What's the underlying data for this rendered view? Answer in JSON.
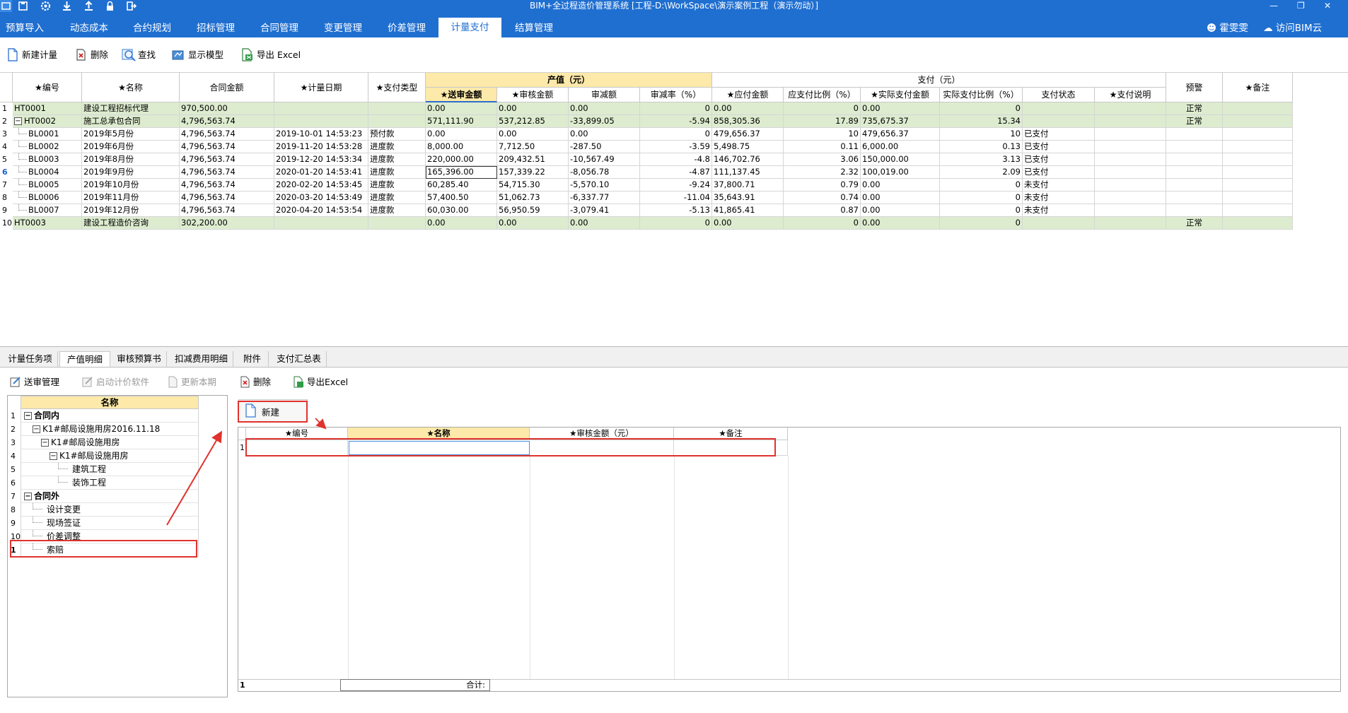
{
  "window": {
    "title": "BIM+全过程造价管理系统 [工程-D:\\WorkSpace\\演示案例工程（演示勿动）]",
    "quick_icons": [
      "app-logo-icon",
      "save-icon",
      "settings-icon",
      "download-icon",
      "upload-icon",
      "lock-icon",
      "exit-icon"
    ],
    "user": "霍雯雯",
    "cloud": "访问BIM云"
  },
  "menu": {
    "tabs": [
      {
        "label": "预算导入"
      },
      {
        "label": "动态成本"
      },
      {
        "label": "合约规划"
      },
      {
        "label": "招标管理"
      },
      {
        "label": "合同管理"
      },
      {
        "label": "变更管理"
      },
      {
        "label": "价差管理"
      },
      {
        "label": "计量支付"
      },
      {
        "label": "结算管理"
      }
    ],
    "active": "计量支付"
  },
  "toolbar": {
    "new": "新建计量",
    "delete": "删除",
    "find": "查找",
    "model": "显示模型",
    "export": "导出 Excel"
  },
  "grid": {
    "group_output": "产值（元）",
    "group_pay": "支付（元）",
    "headers": {
      "code": "★编号",
      "name": "★名称",
      "contract_amount": "合同金额",
      "date": "★计量日期",
      "pay_type": "★支付类型",
      "submitted": "★送审金额",
      "audited": "★审核金额",
      "reduction": "审减额",
      "reduction_rate": "审减率（%）",
      "payable": "★应付金额",
      "payable_ratio": "应支付比例（%）",
      "actual": "★实际支付金额",
      "actual_ratio": "实际支付比例（%）",
      "status": "支付状态",
      "note_pay": "★支付说明",
      "warning": "预警",
      "remark": "★备注"
    },
    "rows": [
      {
        "n": "1",
        "code": "HT0001",
        "name": "建设工程招标代理",
        "contract": "970,500.00",
        "date": "",
        "type": "",
        "submitted": "0.00",
        "audited": "0.00",
        "reduction": "0.00",
        "rate": "0",
        "payable": "0.00",
        "pratio": "0",
        "actual": "0.00",
        "aratio": "0",
        "status": "",
        "warn": "正常"
      },
      {
        "n": "2",
        "code": "HT0002",
        "name": "施工总承包合同",
        "contract": "4,796,563.74",
        "date": "",
        "type": "",
        "submitted": "571,111.90",
        "audited": "537,212.85",
        "reduction": "-33,899.05",
        "rate": "-5.94",
        "payable": "858,305.36",
        "pratio": "17.89",
        "actual": "735,675.37",
        "aratio": "15.34",
        "status": "",
        "warn": "正常"
      },
      {
        "n": "3",
        "code": "BL0001",
        "name": "2019年5月份",
        "contract": "4,796,563.74",
        "date": "2019-10-01 14:53:23",
        "type": "预付款",
        "submitted": "0.00",
        "audited": "0.00",
        "reduction": "0.00",
        "rate": "0",
        "payable": "479,656.37",
        "pratio": "10",
        "actual": "479,656.37",
        "aratio": "10",
        "status": "已支付",
        "warn": ""
      },
      {
        "n": "4",
        "code": "BL0002",
        "name": "2019年6月份",
        "contract": "4,796,563.74",
        "date": "2019-11-20 14:53:28",
        "type": "进度款",
        "submitted": "8,000.00",
        "audited": "7,712.50",
        "reduction": "-287.50",
        "rate": "-3.59",
        "payable": "5,498.75",
        "pratio": "0.11",
        "actual": "6,000.00",
        "aratio": "0.13",
        "status": "已支付",
        "warn": ""
      },
      {
        "n": "5",
        "code": "BL0003",
        "name": "2019年8月份",
        "contract": "4,796,563.74",
        "date": "2019-12-20 14:53:34",
        "type": "进度款",
        "submitted": "220,000.00",
        "audited": "209,432.51",
        "reduction": "-10,567.49",
        "rate": "-4.8",
        "payable": "146,702.76",
        "pratio": "3.06",
        "actual": "150,000.00",
        "aratio": "3.13",
        "status": "已支付",
        "warn": ""
      },
      {
        "n": "6",
        "code": "BL0004",
        "name": "2019年9月份",
        "contract": "4,796,563.74",
        "date": "2020-01-20 14:53:41",
        "type": "进度款",
        "submitted": "165,396.00",
        "audited": "157,339.22",
        "reduction": "-8,056.78",
        "rate": "-4.87",
        "payable": "111,137.45",
        "pratio": "2.32",
        "actual": "100,019.00",
        "aratio": "2.09",
        "status": "已支付",
        "warn": ""
      },
      {
        "n": "7",
        "code": "BL0005",
        "name": "2019年10月份",
        "contract": "4,796,563.74",
        "date": "2020-02-20 14:53:45",
        "type": "进度款",
        "submitted": "60,285.40",
        "audited": "54,715.30",
        "reduction": "-5,570.10",
        "rate": "-9.24",
        "payable": "37,800.71",
        "pratio": "0.79",
        "actual": "0.00",
        "aratio": "0",
        "status": "未支付",
        "warn": ""
      },
      {
        "n": "8",
        "code": "BL0006",
        "name": "2019年11月份",
        "contract": "4,796,563.74",
        "date": "2020-03-20 14:53:49",
        "type": "进度款",
        "submitted": "57,400.50",
        "audited": "51,062.73",
        "reduction": "-6,337.77",
        "rate": "-11.04",
        "payable": "35,643.91",
        "pratio": "0.74",
        "actual": "0.00",
        "aratio": "0",
        "status": "未支付",
        "warn": ""
      },
      {
        "n": "9",
        "code": "BL0007",
        "name": "2019年12月份",
        "contract": "4,796,563.74",
        "date": "2020-04-20 14:53:54",
        "type": "进度款",
        "submitted": "60,030.00",
        "audited": "56,950.59",
        "reduction": "-3,079.41",
        "rate": "-5.13",
        "payable": "41,865.41",
        "pratio": "0.87",
        "actual": "0.00",
        "aratio": "0",
        "status": "未支付",
        "warn": ""
      },
      {
        "n": "10",
        "code": "HT0003",
        "name": "建设工程造价咨询",
        "contract": "302,200.00",
        "date": "",
        "type": "",
        "submitted": "0.00",
        "audited": "0.00",
        "reduction": "0.00",
        "rate": "0",
        "payable": "0.00",
        "pratio": "0",
        "actual": "0.00",
        "aratio": "0",
        "status": "",
        "warn": "正常"
      }
    ]
  },
  "bottom_tabs": [
    "计量任务项",
    "产值明细",
    "审核预算书",
    "扣减费用明细",
    "附件",
    "支付汇总表"
  ],
  "bottom_active": "产值明细",
  "subtoolbar": {
    "review": "送审管理",
    "start_pricing": "启动计价软件",
    "update": "更新本期",
    "delete": "删除",
    "export": "导出Excel"
  },
  "tree": {
    "header": "名称",
    "rows": [
      {
        "n": "1",
        "label": "合同内",
        "level": 0,
        "expander": "−",
        "bold": true
      },
      {
        "n": "2",
        "label": "K1#邮局设施用房2016.11.18",
        "level": 1,
        "expander": "−",
        "bold": false
      },
      {
        "n": "3",
        "label": "K1#邮局设施用房",
        "level": 2,
        "expander": "−",
        "bold": false
      },
      {
        "n": "4",
        "label": "K1#邮局设施用房",
        "level": 3,
        "expander": "−",
        "bold": false
      },
      {
        "n": "5",
        "label": "建筑工程",
        "level": 4,
        "expander": "",
        "bold": false
      },
      {
        "n": "6",
        "label": "装饰工程",
        "level": 4,
        "expander": "",
        "bold": false
      },
      {
        "n": "7",
        "label": "合同外",
        "level": 0,
        "expander": "−",
        "bold": true
      },
      {
        "n": "8",
        "label": "设计变更",
        "level": 1,
        "expander": "",
        "bold": false
      },
      {
        "n": "9",
        "label": "现场签证",
        "level": 1,
        "expander": "",
        "bold": false
      },
      {
        "n": "10",
        "label": "价差调整",
        "level": 1,
        "expander": "",
        "bold": false
      },
      {
        "n": "1",
        "label": "索赔",
        "level": 1,
        "expander": "",
        "bold": false
      }
    ]
  },
  "detail": {
    "new_button": "新建",
    "headers": [
      "★编号",
      "★名称",
      "★审核金额（元）",
      "★备注"
    ],
    "row_num": "1",
    "footer_num": "1",
    "footer_label": "合计:"
  },
  "colors": {
    "titlebar": "#1f6fd1",
    "group_header": "#fde9a9",
    "green_row": "#ddeccf",
    "highlight": "#e0332e"
  }
}
